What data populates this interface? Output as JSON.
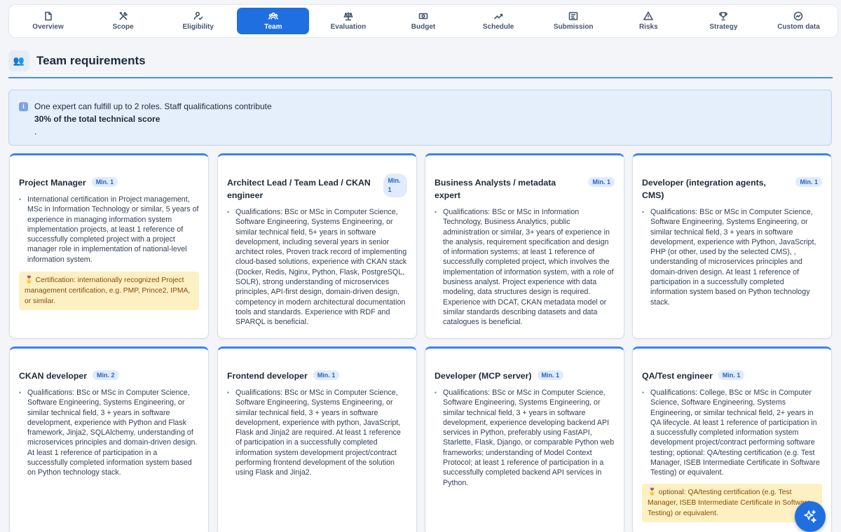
{
  "tabs": [
    {
      "label": "Overview",
      "icon": "document-icon"
    },
    {
      "label": "Scope",
      "icon": "tools-icon"
    },
    {
      "label": "Eligibility",
      "icon": "user-check-icon"
    },
    {
      "label": "Team",
      "icon": "team-icon"
    },
    {
      "label": "Evaluation",
      "icon": "scale-icon"
    },
    {
      "label": "Budget",
      "icon": "money-icon"
    },
    {
      "label": "Schedule",
      "icon": "trend-icon"
    },
    {
      "label": "Submission",
      "icon": "form-icon"
    },
    {
      "label": "Risks",
      "icon": "warning-icon"
    },
    {
      "label": "Strategy",
      "icon": "trophy-icon"
    },
    {
      "label": "Custom data",
      "icon": "gauge-icon"
    }
  ],
  "active_tab": "Team",
  "colors": {
    "accent": "#1f6fe0",
    "card_border": "#3b82f6",
    "cert_bg": "#fdf0c2"
  },
  "section": {
    "title": "Team requirements",
    "icon": "people-icon"
  },
  "info": {
    "text": "One expert can fulfill up to 2 roles. Staff qualifications contribute",
    "bold": "30% of the total technical score",
    "tail": "."
  },
  "cards": [
    {
      "title": "Project Manager",
      "badge": "Min. 1",
      "body": "International certification in Project management, MSc in Information Technology or similar, 5 years of experience in managing information system implementation projects, at least 1 reference of successfully completed project with a project manager role in implementation of national-level information system.",
      "cert": "🎖️ Certification: internationally recognized Project management certification, e.g. PMP, Prince2, IPMA, or similar."
    },
    {
      "title": "Architect Lead / Team Lead / CKAN engineer",
      "badge": "Min. 1",
      "body": "Qualifications: BSc or MSc in Computer Science, Software Engineering, Systems Engineering, or similar technical field, 5+ years in software development, including several years in senior architect roles, Proven track record of implementing cloud-based solutions, experience with CKAN stack (Docker, Redis, Nginx, Python, Flask, PostgreSQL, SOLR), strong understanding of microservices principles, API-first design, domain-driven design, competency in modern architectural documentation tools and standards. Experience with RDF and SPARQL is beneficial."
    },
    {
      "title": "Business Analysts / metadata expert",
      "badge": "Min. 1",
      "body": "Qualifications: BSc or MSc in Information Technology, Business Analytics, public administration or similar, 3+ years of experience in the analysis, requirement specification and design of information systems; at least 1 reference of successfully completed project, which involves the implementation of information system, with a role of business analyst. Project experience with data modeling, data structures design is required. Experience with DCAT, CKAN metadata model or similar standards describing datasets and data catalogues is beneficial."
    },
    {
      "title": "Developer (integration agents, CMS)",
      "badge": "Min. 1",
      "body": "Qualifications: BSc or MSc in Computer Science, Software Engineering, Systems Engineering, or similar technical field, 3 + years in software development, experience with Python, JavaScript, PHP (or other, used by the selected CMS), , understanding of microservices principles and domain-driven design. At least 1 reference of participation in a successfully completed information system based on Python technology stack."
    },
    {
      "title": "CKAN developer",
      "badge": "Min. 2",
      "body": "Qualifications: BSc or MSc in Computer Science, Software Engineering, Systems Engineering, or similar technical field, 3 + years in software development, experience with Python and Flask framework, Jinja2, SQLAlchemy, understanding of microservices principles and domain-driven design. At least 1 reference of participation in a successfully completed information system based on Python technology stack."
    },
    {
      "title": "Frontend developer",
      "badge": "Min. 1",
      "body": "Qualifications: BSc or MSc in Computer Science, Software Engineering, Systems Engineering, or similar technical field, 3 + years in software development, experience with python, JavaScript, Flask and Jinja2 are required. At least 1 reference of participation in a successfully completed information system development project/contract performing frontend development of the solution using Flask and Jinja2."
    },
    {
      "title": "Developer (MCP server)",
      "badge": "Min. 1",
      "body": "Qualifications: BSc or MSc in Computer Science, Software Engineering, Systems Engineering, or similar technical field, 3 + years in software development, experience developing backend API services in Python, preferably using FastAPI, Starlette, Flask, Django, or comparable Python web frameworks; understanding of Model Context Protocol; at least 1 reference of participation in a successfully completed backend API services in Python."
    },
    {
      "title": "QA/Test engineer",
      "badge": "Min. 1",
      "body": "Qualifications: College, BSc or MSc in Computer Science, Software Engineering, Systems Engineering, or similar technical field, 2+ years in QA lifecycle. At least 1 reference of participation in a successfully completed information system development project/contract performing software testing; optional: QA/testing certification (e.g. Test Manager, ISEB Intermediate Certificate in Software Testing) or equivalent.",
      "cert": "🎖️ optional: QA/testing certification (e.g. Test Manager, ISEB Intermediate Certificate in Software Testing) or equivalent."
    }
  ],
  "fab": {
    "icon": "sparkle-icon"
  }
}
